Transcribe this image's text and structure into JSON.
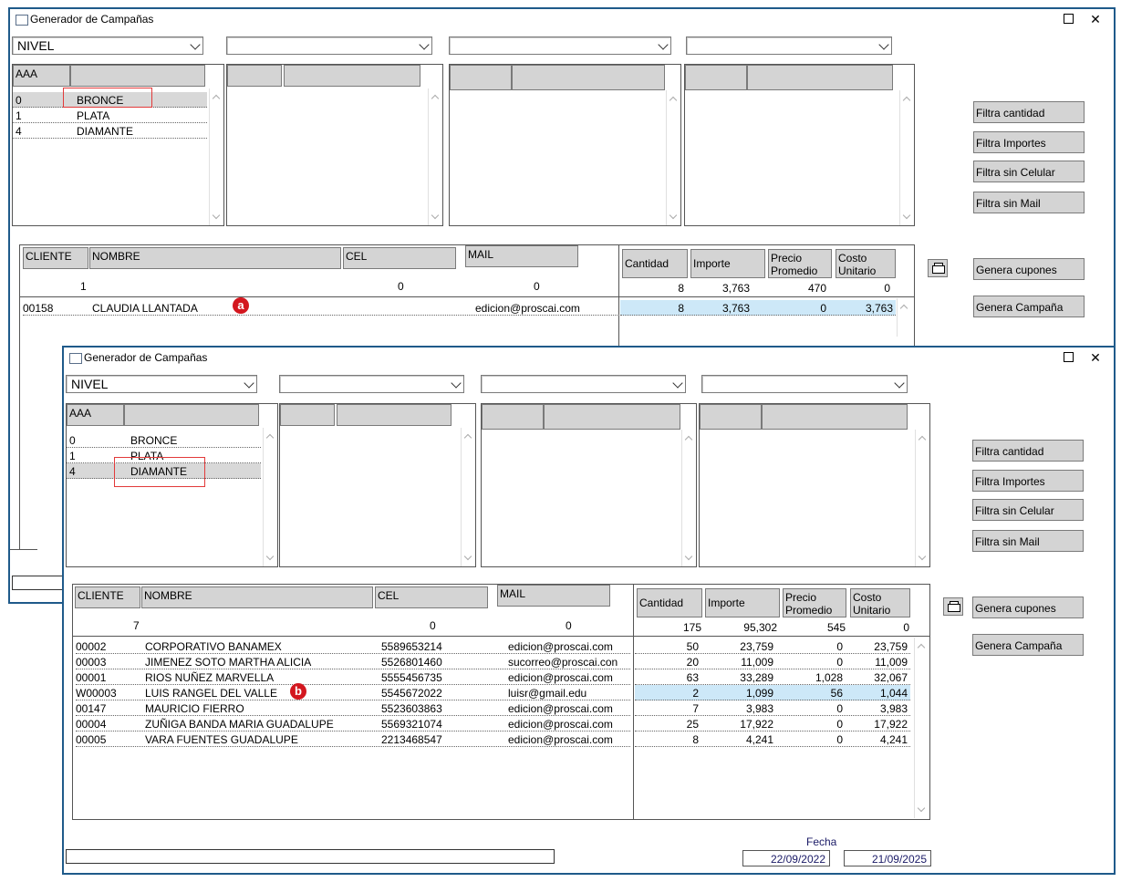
{
  "window_back": {
    "title": "Generador de Campañas",
    "combos": [
      "NIVEL",
      "",
      "",
      ""
    ],
    "list1": {
      "header": "AAA",
      "rows": [
        {
          "id": "0",
          "name": "BRONCE"
        },
        {
          "id": "1",
          "name": "PLATA"
        },
        {
          "id": "4",
          "name": "DIAMANTE"
        }
      ]
    },
    "grid_headers": [
      "CLIENTE",
      "NOMBRE",
      "CEL",
      "MAIL"
    ],
    "totals_headers": [
      "Cantidad",
      "Importe",
      "Precio Promedio",
      "Costo Unitario"
    ],
    "counts": [
      "1",
      "0",
      "0"
    ],
    "totals": [
      "8",
      "3,763",
      "470",
      "0"
    ],
    "rows": [
      {
        "cliente": "00158",
        "nombre": "CLAUDIA LLANTADA",
        "cel": "",
        "mail": "edicion@proscai.com",
        "cantidad": "8",
        "importe": "3,763",
        "precio": "0",
        "costo": "3,763"
      }
    ],
    "buttons": [
      "Filtra cantidad",
      "Filtra Importes",
      "Filtra sin Celular",
      "Filtra sin Mail",
      "Genera cupones",
      "Genera Campaña"
    ],
    "callout": "a"
  },
  "window_front": {
    "title": "Generador de Campañas",
    "combos": [
      "NIVEL",
      "",
      "",
      ""
    ],
    "list1": {
      "header": "AAA",
      "rows": [
        {
          "id": "0",
          "name": "BRONCE"
        },
        {
          "id": "1",
          "name": "PLATA"
        },
        {
          "id": "4",
          "name": "DIAMANTE"
        }
      ]
    },
    "grid_headers": [
      "CLIENTE",
      "NOMBRE",
      "CEL",
      "MAIL"
    ],
    "totals_headers": [
      "Cantidad",
      "Importe",
      "Precio Promedio",
      "Costo Unitario"
    ],
    "counts": [
      "7",
      "0",
      "0"
    ],
    "totals": [
      "175",
      "95,302",
      "545",
      "0"
    ],
    "rows": [
      {
        "cliente": "00002",
        "nombre": "CORPORATIVO BANAMEX",
        "cel": "5589653214",
        "mail": "edicion@proscai.com",
        "cantidad": "50",
        "importe": "23,759",
        "precio": "0",
        "costo": "23,759"
      },
      {
        "cliente": "00003",
        "nombre": "JIMENEZ SOTO MARTHA ALICIA",
        "cel": "5526801460",
        "mail": "sucorreo@proscai.con",
        "cantidad": "20",
        "importe": "11,009",
        "precio": "0",
        "costo": "11,009"
      },
      {
        "cliente": "00001",
        "nombre": "RIOS NUÑEZ MARVELLA",
        "cel": "5555456735",
        "mail": "edicion@proscai.com",
        "cantidad": "63",
        "importe": "33,289",
        "precio": "1,028",
        "costo": "32,067"
      },
      {
        "cliente": "W00003",
        "nombre": "LUIS RANGEL DEL VALLE",
        "cel": "5545672022",
        "mail": "luisr@gmail.edu",
        "cantidad": "2",
        "importe": "1,099",
        "precio": "56",
        "costo": "1,044"
      },
      {
        "cliente": "00147",
        "nombre": "MAURICIO FIERRO",
        "cel": "5523603863",
        "mail": "edicion@proscai.com",
        "cantidad": "7",
        "importe": "3,983",
        "precio": "0",
        "costo": "3,983"
      },
      {
        "cliente": "00004",
        "nombre": "ZUÑIGA BANDA MARIA GUADALUPE",
        "cel": "5569321074",
        "mail": "edicion@proscai.com",
        "cantidad": "25",
        "importe": "17,922",
        "precio": "0",
        "costo": "17,922"
      },
      {
        "cliente": "00005",
        "nombre": "VARA FUENTES GUADALUPE",
        "cel": "2213468547",
        "mail": "edicion@proscai.com",
        "cantidad": "8",
        "importe": "4,241",
        "precio": "0",
        "costo": "4,241"
      }
    ],
    "buttons": [
      "Filtra cantidad",
      "Filtra Importes",
      "Filtra sin Celular",
      "Filtra sin Mail",
      "Genera cupones",
      "Genera Campaña"
    ],
    "fecha_label": "Fecha",
    "date_from": "22/09/2022",
    "date_to": "21/09/2025",
    "callout": "b"
  },
  "icons": [
    "window-icon",
    "maximize-icon",
    "close-icon",
    "chevron-down-icon",
    "printer-icon"
  ],
  "colors": {
    "border": "#1f5a8a",
    "selection": "#cde8f8",
    "header": "#d4d4d4",
    "callout": "#d3171f",
    "highlight": "#e23a3a"
  }
}
